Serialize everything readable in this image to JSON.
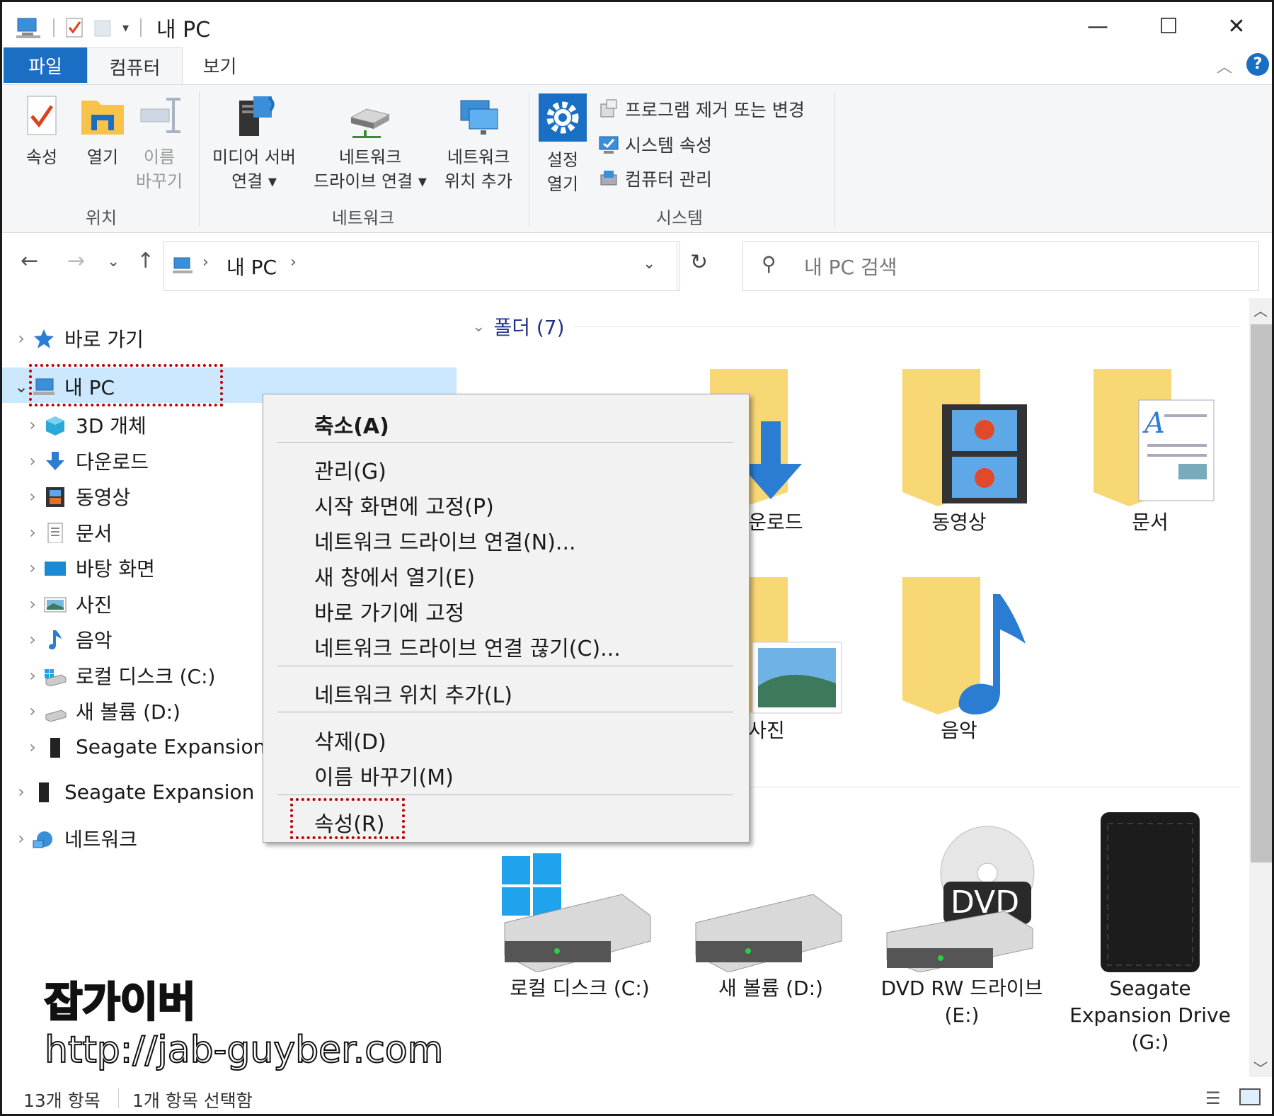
{
  "window": {
    "title": "내 PC",
    "minimize": "—",
    "maximize": "☐",
    "close": "✕"
  },
  "ribbon_tabs": [
    "파일",
    "컴퓨터",
    "보기"
  ],
  "ribbon": {
    "location_group": {
      "label": "위치",
      "properties": "속성",
      "open": "열기",
      "rename_line1": "이름",
      "rename_line2": "바꾸기"
    },
    "network_group": {
      "label": "네트워크",
      "media_line1": "미디어 서버",
      "media_line2": "연결 ▾",
      "map_line1": "네트워크",
      "map_line2": "드라이브 연결 ▾",
      "add_line1": "네트워크",
      "add_line2": "위치 추가"
    },
    "system_group": {
      "label": "시스템",
      "settings_line1": "설정",
      "settings_line2": "열기",
      "uninstall": "프로그램 제거 또는 변경",
      "sys_props": "시스템 속성",
      "manage": "컴퓨터 관리"
    }
  },
  "address": {
    "path": "내 PC",
    "search_placeholder": "내 PC 검색"
  },
  "nav_pane": {
    "quick_access": "바로 가기",
    "this_pc": "내 PC",
    "children": [
      "3D 개체",
      "다운로드",
      "동영상",
      "문서",
      "바탕 화면",
      "사진",
      "음악",
      "로컬 디스크 (C:)",
      "새 볼륨 (D:)",
      "Seagate Expansion D"
    ],
    "seagate": "Seagate Expansion D",
    "network": "네트워크"
  },
  "content": {
    "folders_header": "폴더 (7)",
    "folders": [
      "다운로드",
      "동영상",
      "문서",
      "사진",
      "음악"
    ],
    "drives": [
      {
        "line1": "로컬 디스크 (C:)",
        "line2": ""
      },
      {
        "line1": "새 볼륨 (D:)",
        "line2": ""
      },
      {
        "line1": "DVD RW 드라이브",
        "line2": "(E:)"
      },
      {
        "line1": "Seagate",
        "line2": "Expansion Drive",
        "line3": "(G:)"
      }
    ]
  },
  "context_menu": {
    "items": [
      "축소(A)",
      "관리(G)",
      "시작 화면에 고정(P)",
      "네트워크 드라이브 연결(N)...",
      "새 창에서 열기(E)",
      "바로 가기에 고정",
      "네트워크 드라이브 연결 끊기(C)...",
      "네트워크 위치 추가(L)",
      "삭제(D)",
      "이름 바꾸기(M)",
      "속성(R)"
    ]
  },
  "status": {
    "count": "13개 항목",
    "selected": "1개 항목 선택함"
  },
  "watermark": {
    "name": "잡가이버",
    "url": "http://jab-guyber.com"
  },
  "colors": {
    "accent": "#1a6fc4",
    "selection": "#cce8ff",
    "folder": "#f8d775",
    "highlight_box": "#c00000"
  }
}
